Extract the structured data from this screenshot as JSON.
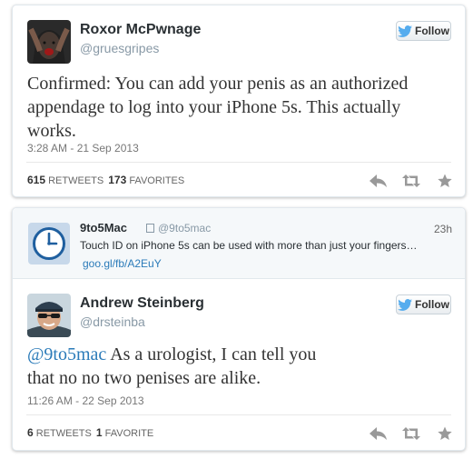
{
  "tweet1": {
    "name": "Roxor McPwnage",
    "handle": "@gruesgripes",
    "follow_label": "Follow",
    "text": "Confirmed:  You can add your penis as an authorized appendage to log into your iPhone 5s.   This actually works.",
    "timestamp": "3:28 AM - 21 Sep 2013",
    "retweets_count": "615",
    "retweets_label": "RETWEETS",
    "favorites_count": "173",
    "favorites_label": "FAVORITES"
  },
  "embed": {
    "name": "9to5Mac",
    "handle": "@9to5mac",
    "time": "23h",
    "text": "Touch ID on iPhone 5s can be used with more than just your fingers…",
    "link": "goo.gl/fb/A2EuY"
  },
  "tweet2": {
    "name": "Andrew Steinberg",
    "handle": "@drsteinba",
    "follow_label": "Follow",
    "mention": "@9to5mac",
    "text": " As a urologist, I can tell you that no no two penises are alike.",
    "timestamp": "11:26 AM - 22 Sep 2013",
    "retweets_count": "6",
    "retweets_label": "RETWEETS",
    "favorites_count": "1",
    "favorites_label": "FAVORITE"
  },
  "icons": {
    "follow": "twitter-bird-icon",
    "reply": "reply-icon",
    "retweet": "retweet-icon",
    "favorite": "star-icon",
    "embed_avatar": "clock-icon"
  },
  "colors": {
    "twitter_blue": "#55acee",
    "link": "#2b7bb9",
    "action_gray": "#999999"
  }
}
